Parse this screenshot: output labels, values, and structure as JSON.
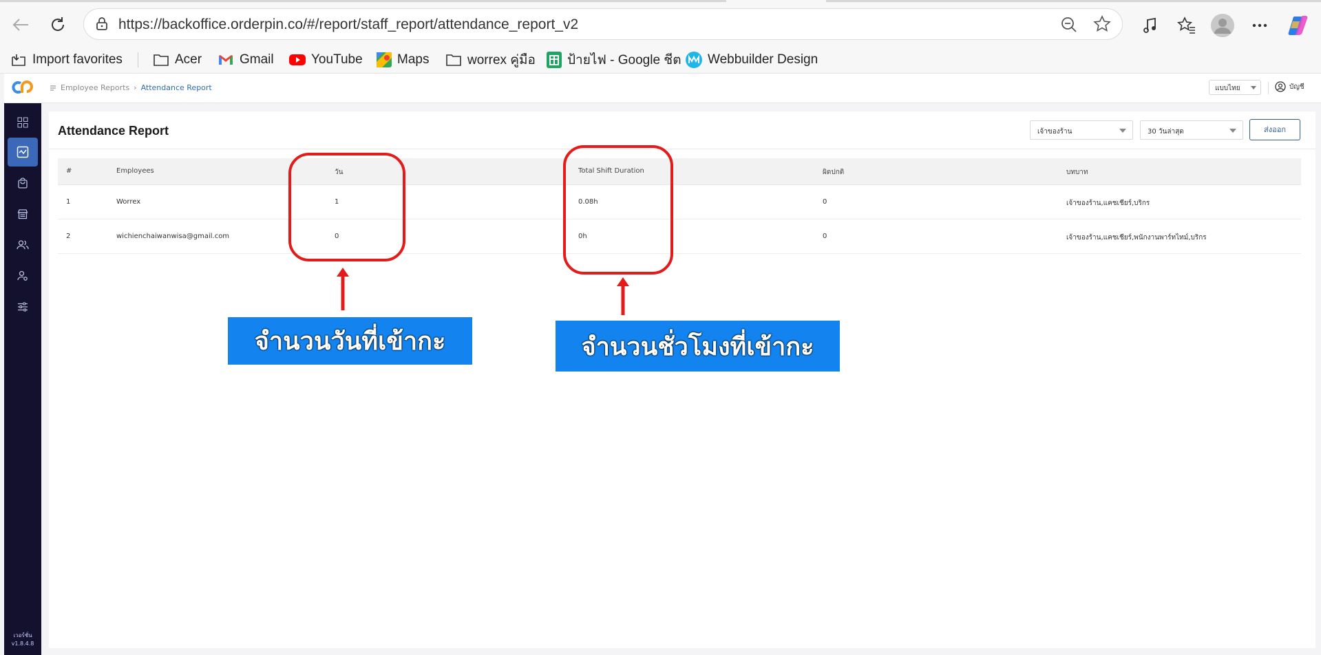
{
  "browser": {
    "url": "https://backoffice.orderpin.co/#/report/staff_report/attendance_report_v2",
    "bookmarks": [
      {
        "label": "Import favorites",
        "icon": "import-icon"
      },
      {
        "label": "Acer",
        "icon": "folder-icon"
      },
      {
        "label": "Gmail",
        "icon": "gmail-icon"
      },
      {
        "label": "YouTube",
        "icon": "youtube-icon"
      },
      {
        "label": "Maps",
        "icon": "maps-icon"
      },
      {
        "label": "worrex คู่มือ",
        "icon": "folder-icon"
      },
      {
        "label": "ป้ายไฟ - Google ชีต",
        "icon": "sheets-icon"
      },
      {
        "label": "Webbuilder Design",
        "icon": "webbuilder-icon"
      }
    ]
  },
  "header": {
    "breadcrumb": {
      "parent": "Employee Reports",
      "current": "Attendance Report"
    },
    "language": "แบบไทย",
    "account": "บัญชี"
  },
  "sidebar": {
    "items": [
      {
        "icon": "dashboard-grid-icon",
        "active": false
      },
      {
        "icon": "report-chart-icon",
        "active": true
      },
      {
        "icon": "shopping-bag-icon",
        "active": false
      },
      {
        "icon": "store-icon",
        "active": false
      },
      {
        "icon": "users-icon",
        "active": false
      },
      {
        "icon": "user-settings-icon",
        "active": false
      },
      {
        "icon": "sliders-icon",
        "active": false
      }
    ],
    "version_label": "เวอร์ชั่น",
    "version": "v1.8.4.8"
  },
  "report": {
    "title": "Attendance Report",
    "filter_role": "เจ้าของร้าน",
    "filter_range": "30 วันล่าสุด",
    "export_label": "ส่งออก",
    "columns": [
      "#",
      "Employees",
      "วัน",
      "Total Shift Duration",
      "ผิดปกติ",
      "บทบาท"
    ],
    "rows": [
      {
        "no": "1",
        "employee": "Worrex",
        "days": "1",
        "duration": "0.08h",
        "abnormal": "0",
        "roles": "เจ้าของร้าน,แคชเชียร์,บริกร"
      },
      {
        "no": "2",
        "employee": "wichienchaiwanwisa@gmail.com",
        "days": "0",
        "duration": "0h",
        "abnormal": "0",
        "roles": "เจ้าของร้าน,แคชเชียร์,พนักงานพาร์ทไทม์,บริกร"
      }
    ]
  },
  "annotations": {
    "days_label": "จำนวนวันที่เข้ากะ",
    "hours_label": "จำนวนชั่วโมงที่เข้ากะ",
    "box_color": "#e31b1b",
    "label_bg": "#1384ef"
  }
}
